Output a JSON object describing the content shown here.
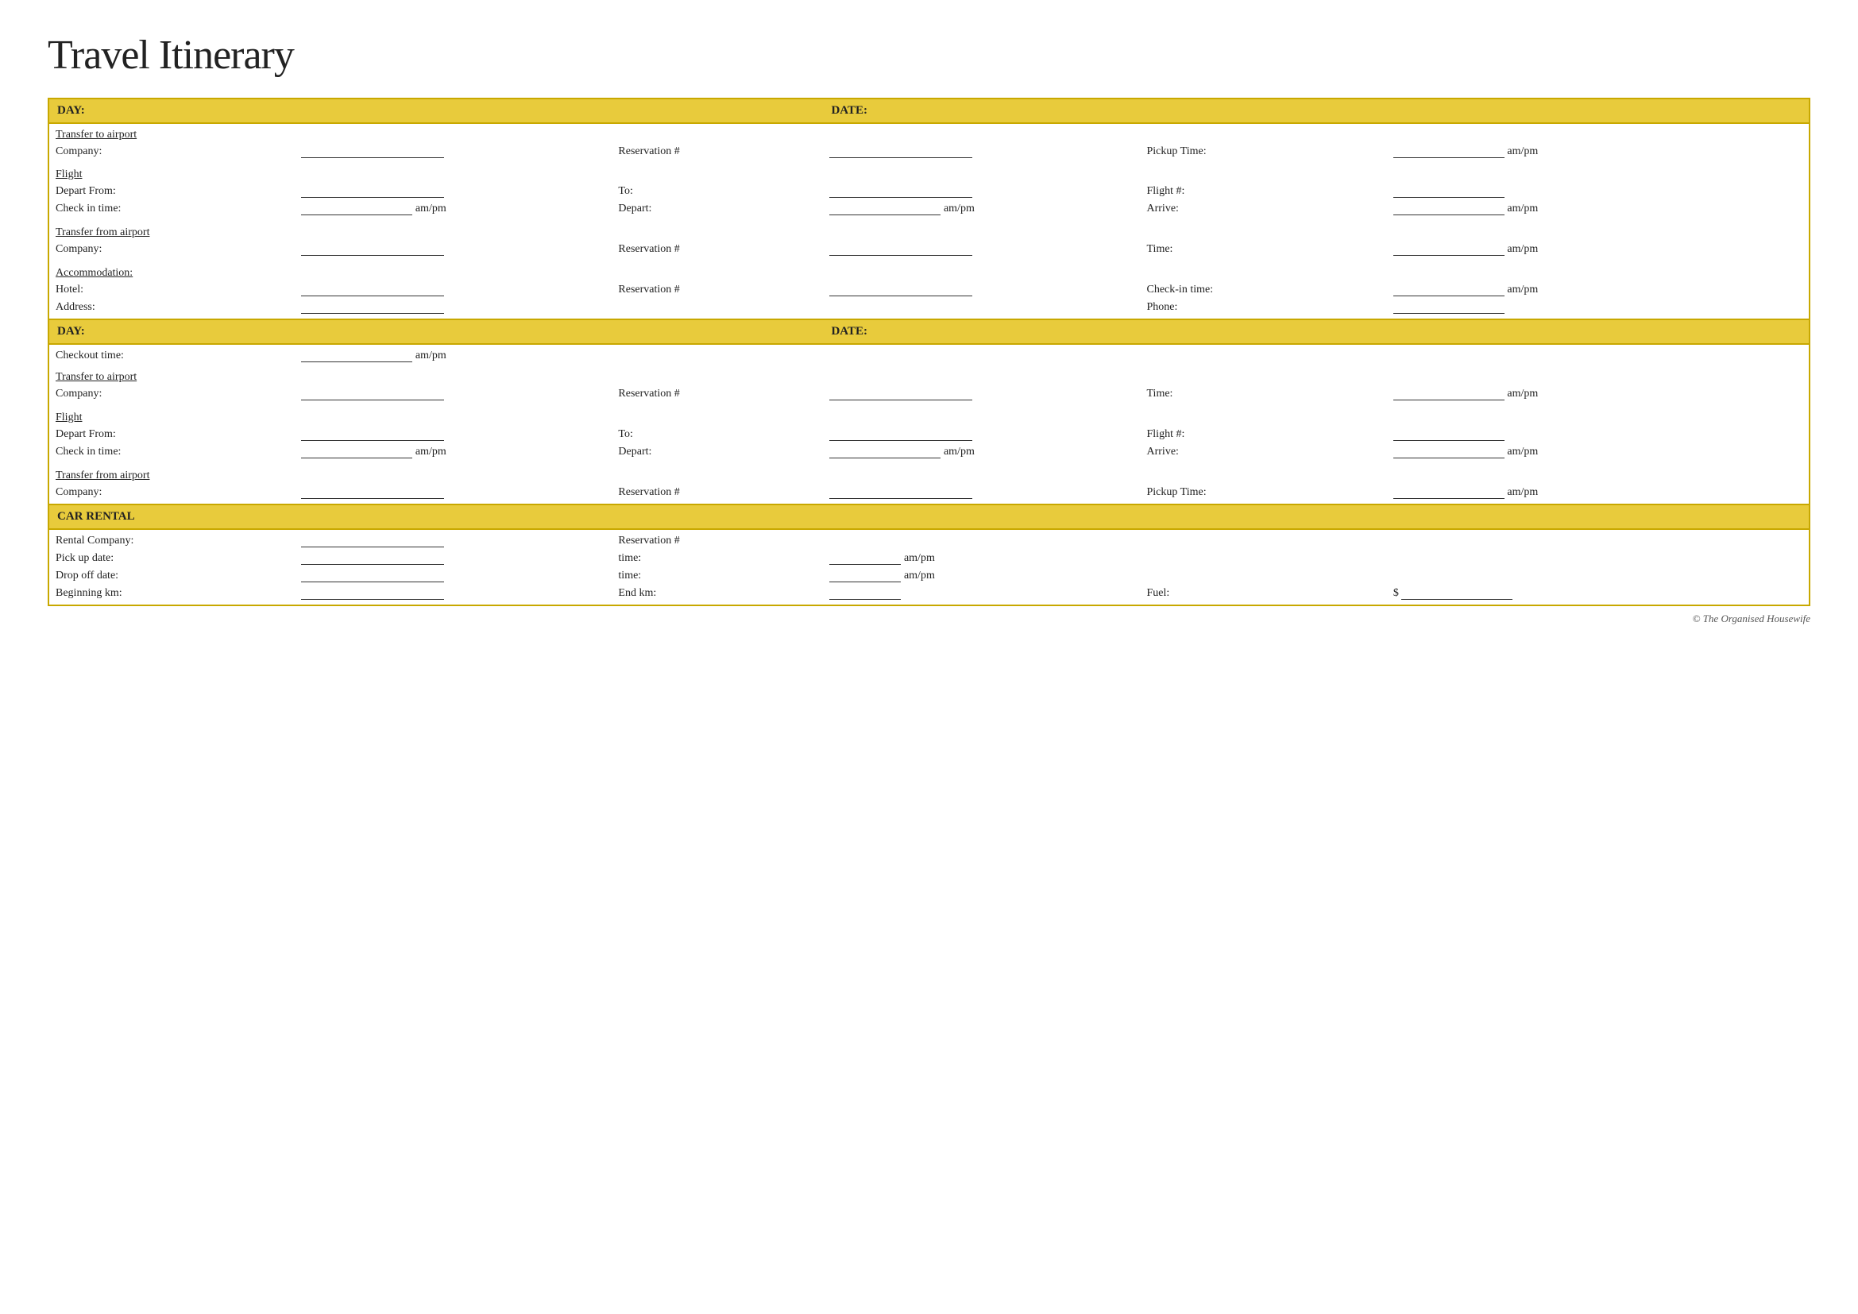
{
  "title": "Travel Itinerary",
  "footer": "© The Organised Housewife",
  "section1": {
    "day_label": "DAY:",
    "date_label": "DATE:",
    "transfer_to_airport": "Transfer to airport",
    "company_label": "Company:",
    "reservation_label": "Reservation #",
    "pickup_time_label": "Pickup Time:",
    "ampm": "am/pm",
    "flight_label": "Flight",
    "depart_from_label": "Depart From:",
    "to_label": "To:",
    "flight_hash_label": "Flight #:",
    "check_in_time_label": "Check in time:",
    "depart_label": "Depart:",
    "arrive_label": "Arrive:",
    "transfer_from_airport": "Transfer from airport",
    "time_label": "Time:",
    "accommodation_label": "Accommodation:",
    "hotel_label": "Hotel:",
    "checkin_time_label": "Check-in time:",
    "address_label": "Address:",
    "phone_label": "Phone:"
  },
  "section2": {
    "day_label": "DAY:",
    "date_label": "DATE:",
    "checkout_time_label": "Checkout time:",
    "ampm": "am/pm",
    "transfer_to_airport": "Transfer to airport",
    "company_label": "Company:",
    "reservation_label": "Reservation #",
    "time_label": "Time:",
    "flight_label": "Flight",
    "depart_from_label": "Depart From:",
    "to_label": "To:",
    "flight_hash_label": "Flight #:",
    "check_in_time_label": "Check in time:",
    "depart_label": "Depart:",
    "arrive_label": "Arrive:",
    "transfer_from_airport": "Transfer from airport",
    "company2_label": "Company:",
    "reservation2_label": "Reservation #",
    "pickup_time_label": "Pickup Time:"
  },
  "section3": {
    "car_rental_label": "CAR RENTAL",
    "rental_company_label": "Rental Company:",
    "reservation_label": "Reservation #",
    "pickup_date_label": "Pick up date:",
    "time_label": "time:",
    "dropoff_date_label": "Drop off date:",
    "time2_label": "time:",
    "beginning_km_label": "Beginning km:",
    "end_km_label": "End km:",
    "fuel_label": "Fuel:",
    "dollar": "$",
    "ampm": "am/pm"
  }
}
